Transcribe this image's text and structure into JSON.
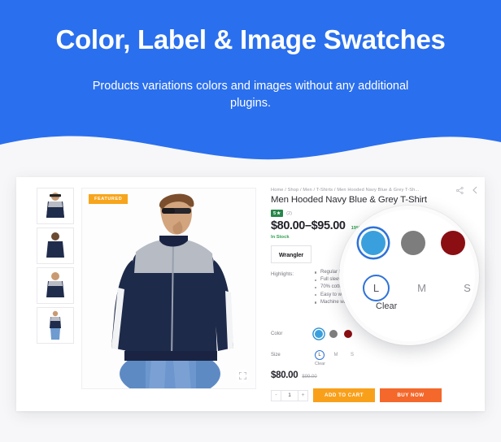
{
  "hero": {
    "title": "Color, Label & Image Swatches",
    "subtitle": "Products variations colors and images without any additional plugins.",
    "bg_color": "#2A6FEE",
    "text_color": "#ffffff"
  },
  "product": {
    "breadcrumb": "Home / Shop / Men / T-Shirts / Men Hooded Navy Blue & Grey T-Sh...",
    "title": "Men Hooded Navy Blue & Grey T-Shirt",
    "rating_value": "5",
    "rating_star": "★",
    "rating_badge_color": "#26874a",
    "review_count": "(2)",
    "price_range": "$80.00–$95.00",
    "discount": "19% Off",
    "stock_status": "In Stock",
    "stock_color": "#2fa14f",
    "brand": "Wrangler",
    "featured_badge": "FEATURED",
    "featured_color": "#f7a51c",
    "highlights_label": "Highlights:",
    "highlights": [
      "Regular Fit.",
      "Full sleeves.",
      "70% cotton, 30% polyester.",
      "Easy to wear and versatile in C...",
      "Machine wash, tumble dry."
    ],
    "color_label": "Color",
    "colors": [
      {
        "name": "blue",
        "hex": "#3aa0dd",
        "selected": true
      },
      {
        "name": "grey",
        "hex": "#7d7d7d",
        "selected": false
      },
      {
        "name": "dark-red",
        "hex": "#8b0e12",
        "selected": false
      }
    ],
    "size_label": "Size",
    "sizes": [
      {
        "label": "L",
        "selected": true
      },
      {
        "label": "M",
        "selected": false
      },
      {
        "label": "S",
        "selected": false
      }
    ],
    "clear_label": "Clear",
    "final_price": "$80.00",
    "old_price": "$99.00",
    "qty_minus": "-",
    "qty_value": "1",
    "qty_plus": "+",
    "add_to_cart_label": "ADD TO CART",
    "add_to_cart_color": "#f9a01b",
    "buy_now_label": "BUY NOW",
    "buy_now_color": "#f4682b",
    "share_icon": "share-icon",
    "back_icon": "chevron-left-icon",
    "expand_icon": "expand-icon"
  },
  "magnifier": {
    "colors": [
      {
        "name": "blue",
        "hex": "#3aa0dd",
        "selected": true
      },
      {
        "name": "grey",
        "hex": "#7d7d7d",
        "selected": false
      },
      {
        "name": "dark-red",
        "hex": "#8b0e12",
        "selected": false
      }
    ],
    "sizes": [
      {
        "label": "L",
        "selected": true
      },
      {
        "label": "M",
        "selected": false
      },
      {
        "label": "S",
        "selected": false
      }
    ],
    "clear_label": "Clear"
  }
}
